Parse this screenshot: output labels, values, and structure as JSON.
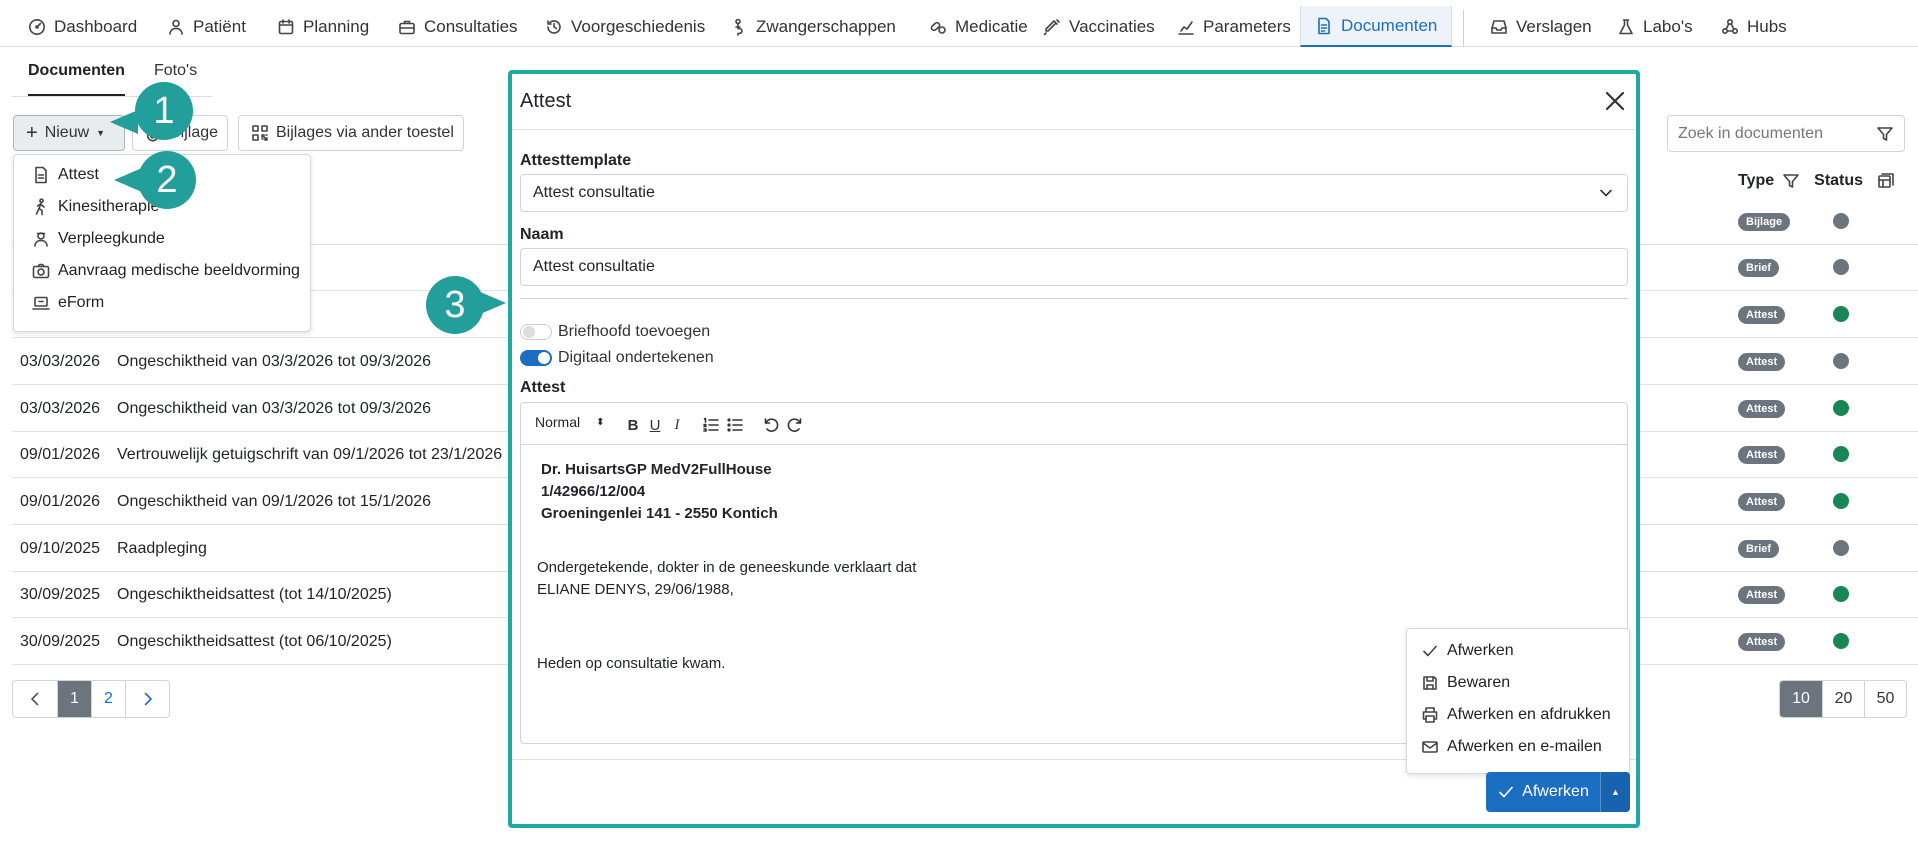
{
  "nav": {
    "items": [
      {
        "label": "Dashboard",
        "icon": "dashboard-icon"
      },
      {
        "label": "Patiënt",
        "icon": "person-icon"
      },
      {
        "label": "Planning",
        "icon": "calendar-icon"
      },
      {
        "label": "Consultaties",
        "icon": "briefcase-icon"
      },
      {
        "label": "Voorgeschiedenis",
        "icon": "history-icon"
      },
      {
        "label": "Zwangerschappen",
        "icon": "pregnancy-icon"
      },
      {
        "label": "Medicatie",
        "icon": "pills-icon"
      },
      {
        "label": "Vaccinaties",
        "icon": "syringe-icon"
      },
      {
        "label": "Parameters",
        "icon": "chart-icon"
      },
      {
        "label": "Documenten",
        "icon": "document-icon",
        "active": true
      },
      {
        "label": "Verslagen",
        "icon": "inbox-icon"
      },
      {
        "label": "Labo's",
        "icon": "flask-icon"
      },
      {
        "label": "Hubs",
        "icon": "hubs-icon"
      }
    ]
  },
  "subtabs": {
    "documents": "Documenten",
    "photos": "Foto's"
  },
  "toolbar": {
    "new_label": "Nieuw",
    "attach_label": "Bijlage",
    "attach_device_label": "Bijlages via ander toestel",
    "search_placeholder": "Zoek in documenten"
  },
  "new_menu": {
    "items": [
      {
        "label": "Attest",
        "icon": "document-icon"
      },
      {
        "label": "Kinesitherapie",
        "icon": "walking-icon"
      },
      {
        "label": "Verpleegkunde",
        "icon": "nurse-icon"
      },
      {
        "label": "Aanvraag medische beeldvorming",
        "icon": "camera-icon"
      },
      {
        "label": "eForm",
        "icon": "laptop-icon"
      }
    ]
  },
  "callouts": [
    "1",
    "2",
    "3"
  ],
  "table": {
    "headers": {
      "type": "Type",
      "status": "Status"
    },
    "rows": [
      {
        "date": "",
        "title": "",
        "type": "Bijlage",
        "status_color": "#6c757d"
      },
      {
        "date": "",
        "title": "",
        "type": "Brief",
        "status_color": "#6c757d"
      },
      {
        "date": "",
        "title": "",
        "type": "Attest",
        "status_color": "#198754"
      },
      {
        "date": "03/03/2026",
        "title": "Ongeschiktheid van 03/3/2026 tot 09/3/2026",
        "type": "Attest",
        "status_color": "#6c757d"
      },
      {
        "date": "03/03/2026",
        "title": "Ongeschiktheid van 03/3/2026 tot 09/3/2026",
        "type": "Attest",
        "status_color": "#198754"
      },
      {
        "date": "09/01/2026",
        "title": "Vertrouwelijk getuigschrift van 09/1/2026 tot 23/1/2026",
        "type": "Attest",
        "status_color": "#198754"
      },
      {
        "date": "09/01/2026",
        "title": "Ongeschiktheid van 09/1/2026 tot 15/1/2026",
        "type": "Attest",
        "status_color": "#198754"
      },
      {
        "date": "09/10/2025",
        "title": "Raadpleging",
        "type": "Brief",
        "status_color": "#6c757d"
      },
      {
        "date": "30/09/2025",
        "title": "Ongeschiktheidsattest (tot 14/10/2025)",
        "type": "Attest",
        "status_color": "#198754"
      },
      {
        "date": "30/09/2025",
        "title": "Ongeschiktheidsattest (tot 06/10/2025)",
        "type": "Attest",
        "status_color": "#198754"
      }
    ]
  },
  "pagination": {
    "pages": [
      "1",
      "2"
    ],
    "current": "1",
    "sizes": [
      "10",
      "20",
      "50"
    ],
    "current_size": "10"
  },
  "modal": {
    "title": "Attest",
    "template_label": "Attesttemplate",
    "template_value": "Attest consultatie",
    "name_label": "Naam",
    "name_value": "Attest consultatie",
    "letterhead_label": "Briefhoofd toevoegen",
    "letterhead_on": false,
    "sign_label": "Digitaal ondertekenen",
    "sign_on": true,
    "editor_label": "Attest",
    "editor_format": "Normal",
    "editor": {
      "header_lines": [
        "Dr. HuisartsGP MedV2FullHouse",
        "1/42966/12/004",
        "Groeningenlei 141 - 2550 Kontich"
      ],
      "body_lines": [
        "Ondergetekende, dokter in de geneeskunde verklaart dat",
        "ELIANE DENYS, 29/06/1988,"
      ],
      "closing": "Heden op consultatie kwam."
    },
    "finish_menu": [
      {
        "label": "Afwerken",
        "icon": "check-icon"
      },
      {
        "label": "Bewaren",
        "icon": "save-icon"
      },
      {
        "label": "Afwerken en afdrukken",
        "icon": "printer-icon"
      },
      {
        "label": "Afwerken en e-mailen",
        "icon": "envelope-icon"
      }
    ],
    "finish_button": "Afwerken"
  },
  "colors": {
    "accent": "#1b6ec2",
    "callout": "#229e9b",
    "modal_border": "#1fa8a4",
    "status_green": "#198754",
    "status_grey": "#6c757d"
  }
}
